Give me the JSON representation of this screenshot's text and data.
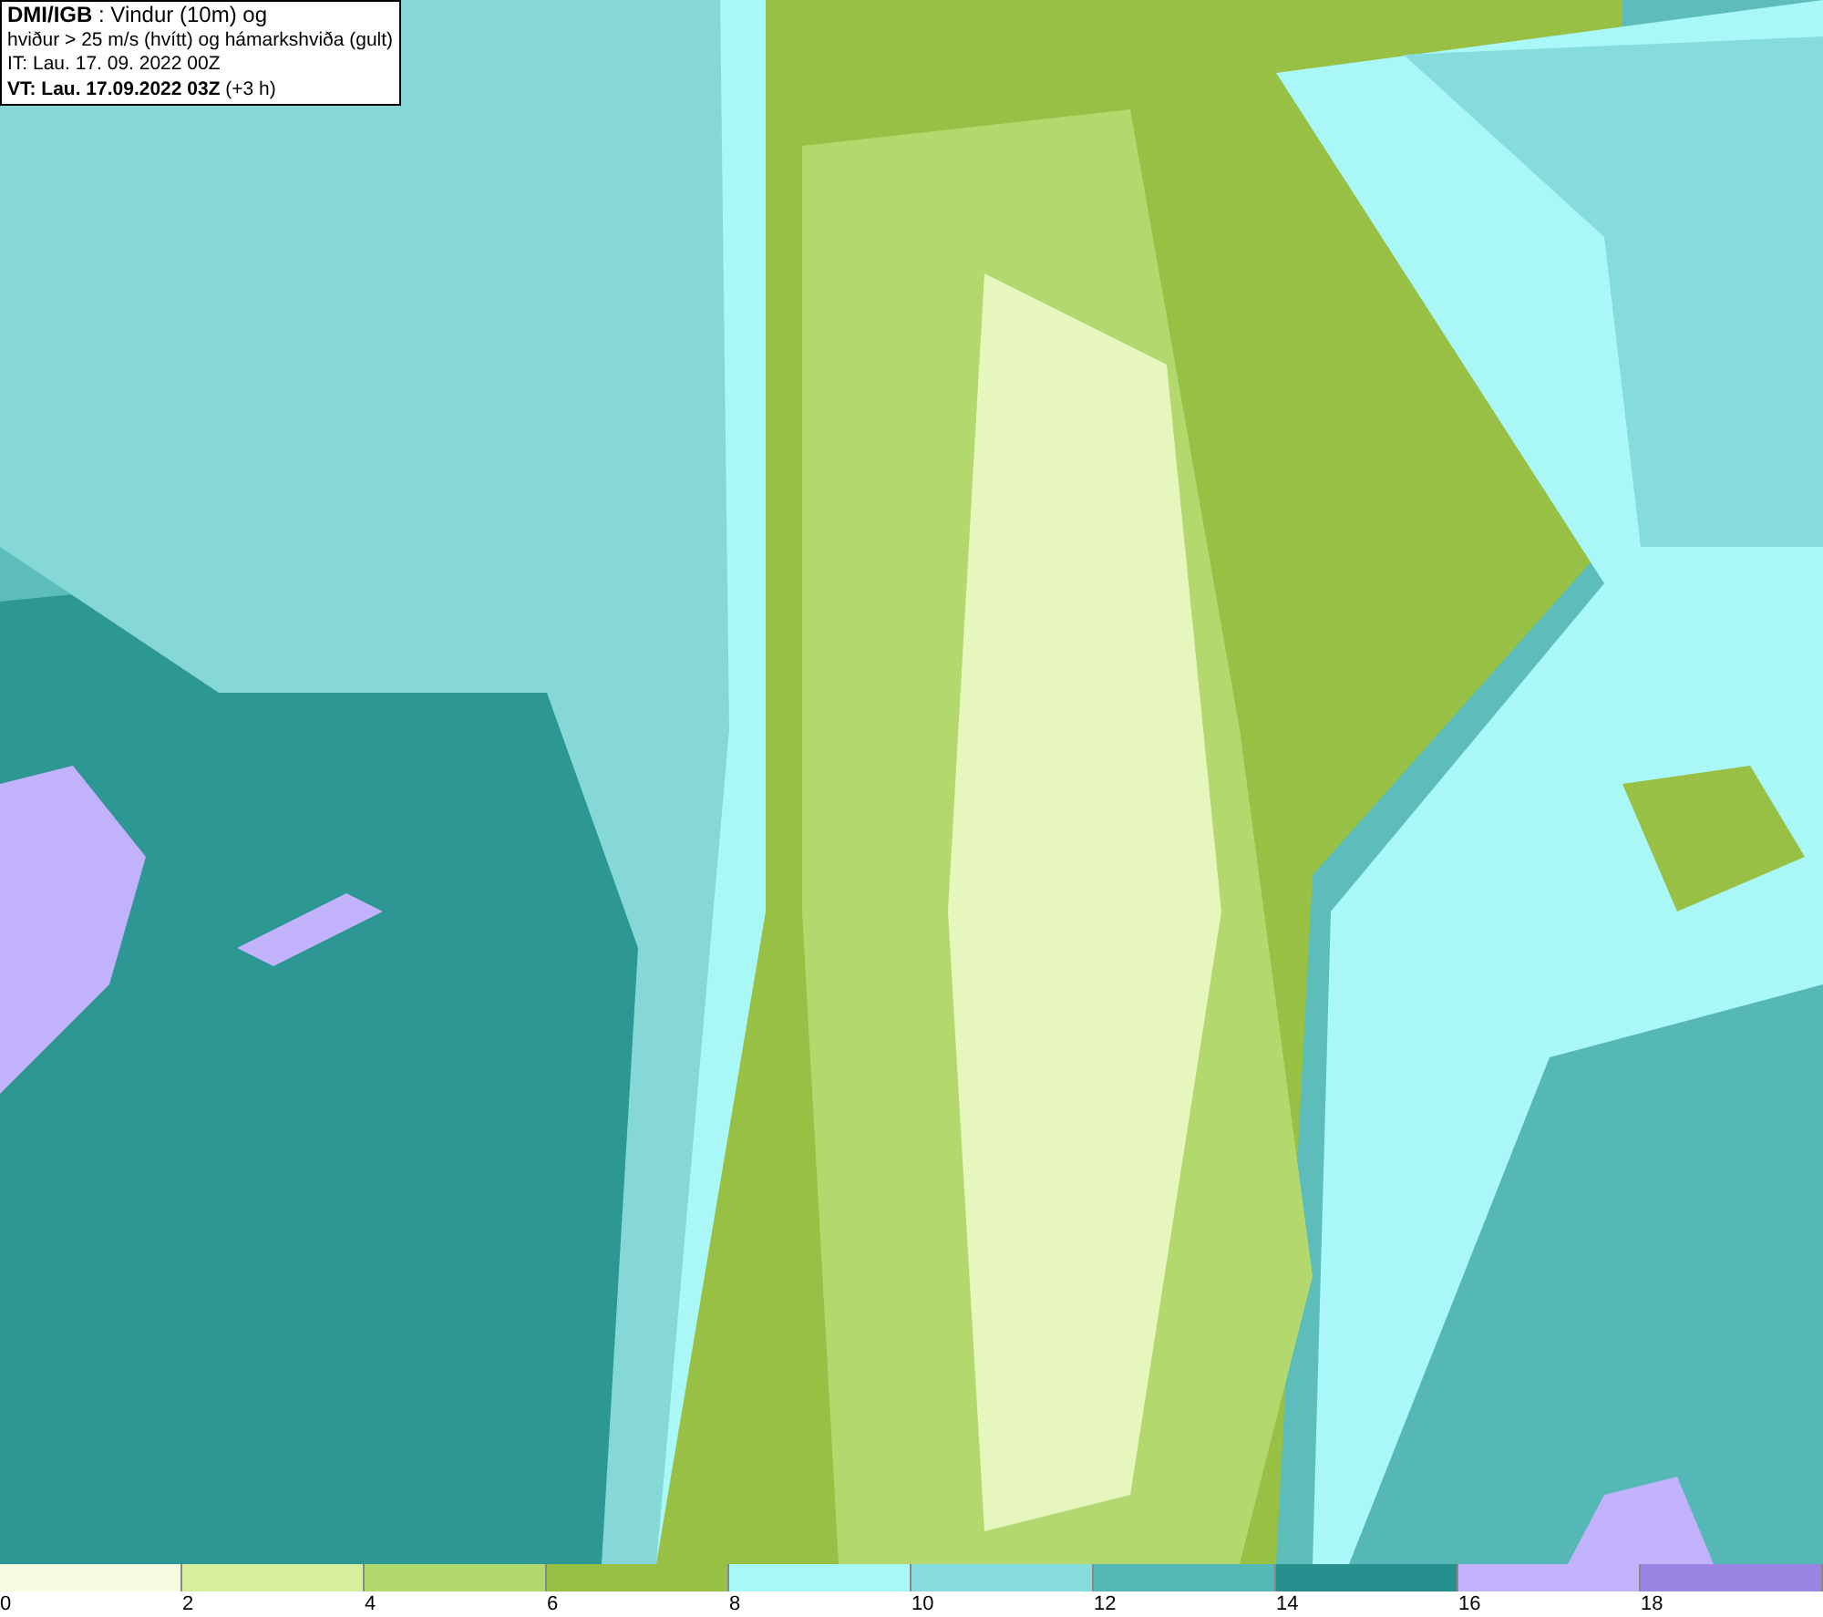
{
  "info_box": {
    "lines": [
      "**DMI/IGB** : Vindur (10m) og",
      "hviður > 25 m/s (hvítt) og hámarkshviða (gult)",
      "IT: Lau. 17. 09. 2022 00Z",
      "**VT: Lau. 17.09.2022 03Z** (+3 h)"
    ]
  },
  "legend": {
    "bins": [
      {
        "label": "0",
        "color": "#f5fce0"
      },
      {
        "label": "2",
        "color": "#d5ef9c"
      },
      {
        "label": "4",
        "color": "#b2d86e"
      },
      {
        "label": "6",
        "color": "#97c044"
      },
      {
        "label": "8",
        "color": "#aaf7f7"
      },
      {
        "label": "10",
        "color": "#86dcdc"
      },
      {
        "label": "12",
        "color": "#55b8b6"
      },
      {
        "label": "14",
        "color": "#25908d"
      },
      {
        "label": "16",
        "color": "#c2b1fb"
      },
      {
        "label": "18",
        "color": "#9a86e2"
      }
    ]
  }
}
